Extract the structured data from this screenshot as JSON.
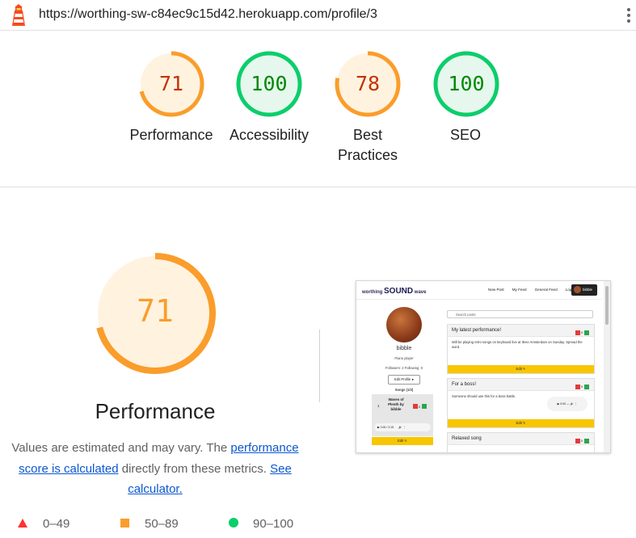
{
  "browser": {
    "url": "https://worthing-sw-c84ec9c15d42.herokuapp.com/profile/3",
    "logo_icon": "lighthouse-icon",
    "menu_icon": "kebab-menu-icon"
  },
  "colors": {
    "average": "#fa9d2b",
    "average_bg": "#fff3e0",
    "average_text": "#c33300",
    "pass": "#0cce6b",
    "pass_bg": "#e6f8ee",
    "pass_text": "#008800",
    "fail": "#ff3333"
  },
  "scores": [
    {
      "id": "performance",
      "value": "71",
      "label": "Performance",
      "fraction": 0.71,
      "rating": "average"
    },
    {
      "id": "accessibility",
      "value": "100",
      "label": "Accessibility",
      "fraction": 1.0,
      "rating": "pass"
    },
    {
      "id": "best-practices",
      "value": "78",
      "label": "Best\nPractices",
      "fraction": 0.78,
      "rating": "average"
    },
    {
      "id": "seo",
      "value": "100",
      "label": "SEO",
      "fraction": 1.0,
      "rating": "pass"
    }
  ],
  "detail": {
    "score": "71",
    "fraction": 0.71,
    "title": "Performance",
    "desc_before": "Values are estimated and may vary. The ",
    "desc_link": "performance score is calculated",
    "desc_middle": " directly from these metrics. ",
    "desc_link2": "See calculator."
  },
  "legend": [
    {
      "shape": "triangle",
      "range": "0–49"
    },
    {
      "shape": "square",
      "range": "50–89"
    },
    {
      "shape": "circle",
      "range": "90–100"
    }
  ],
  "screenshot": {
    "brand_left": "worthing",
    "brand_mid": "SOUND",
    "brand_right": "wave",
    "nav": [
      "New Post",
      "My Feed",
      "General Feed",
      "Log out"
    ],
    "user": "bibble",
    "username": "bibble",
    "bio": "Piano player",
    "follows": "Followers: 2 Following: 0",
    "edit_profile": "Edit Profile",
    "songs_heading": "Songs (1/3)",
    "song_index": "1",
    "song_title": "Waves of Plenth by bibble",
    "song_time": "0:00 / 2:15",
    "edit_btn": "Edit",
    "search_placeholder": "Search posts",
    "posts": [
      {
        "title": "My latest performance!",
        "body": "Will be playing retro songs on keyboard live at Ilene Amsterdam on Sunday. Spread the word.",
        "likes": "0",
        "button": "Edit"
      },
      {
        "title": "For a boss!",
        "body": "Someone should use this for a boss battle.",
        "likes": "0",
        "button": "Edit"
      },
      {
        "title": "Relaxed song",
        "body": "",
        "likes": "0",
        "button": ""
      }
    ]
  }
}
